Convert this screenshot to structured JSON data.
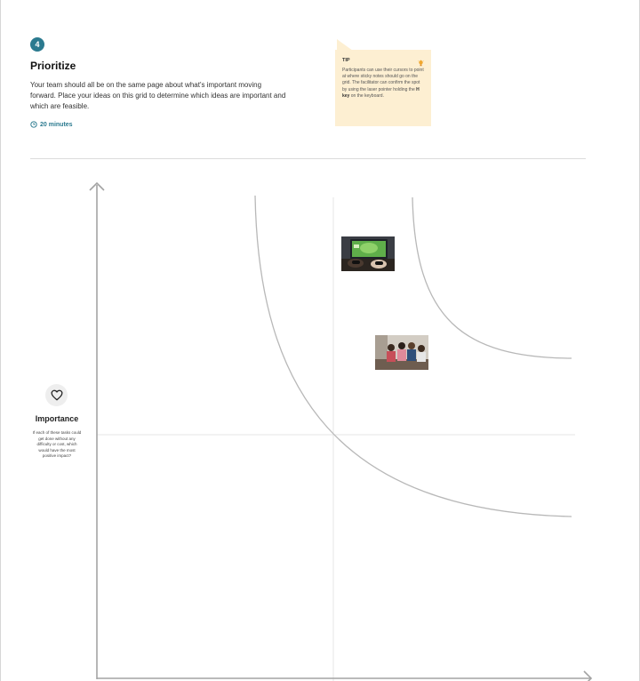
{
  "step": {
    "number": "4",
    "title": "Prioritize",
    "description": "Your team should all be on the same page about what's important moving forward. Place your ideas on this grid to determine which ideas are important and which are feasible.",
    "duration": "20 minutes"
  },
  "tip": {
    "label": "TIP",
    "text_before": "Participants can use their cursors to point at where sticky notes should go on the grid. The facilitator can confirm the spot by using the laser pointer holding the ",
    "key": "H key",
    "text_after": " on the keyboard."
  },
  "axis_y": {
    "label": "Importance",
    "description": "If each of these tasks could get done without any difficulty or cost, which would have the most positive impact?",
    "icon": "heart-icon"
  },
  "images": [
    {
      "name": "game-controllers-photo",
      "icon": "photo-icon"
    },
    {
      "name": "friends-on-couch-photo",
      "icon": "photo-icon"
    }
  ],
  "colors": {
    "accent": "#2b7a8f",
    "tip_background": "#fdefd2",
    "axis": "#9a9a9a",
    "curve": "#b5b5b5",
    "gridline": "#e6e6e6"
  }
}
